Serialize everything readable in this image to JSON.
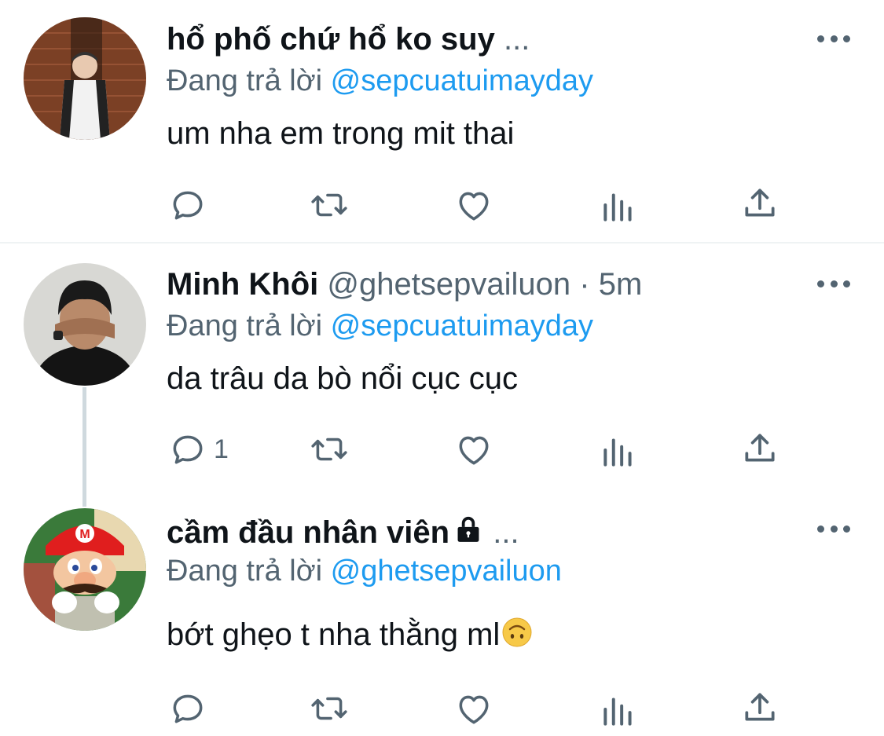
{
  "tweets": [
    {
      "name": "hổ phố chứ hổ ko suy",
      "ellipsis": "...",
      "reply_prefix": "Đang trả lời",
      "reply_to": "@sepcuatuimayday",
      "text": "um nha em trong mit thai",
      "reply_count": ""
    },
    {
      "name": "Minh Khôi",
      "handle": "@ghetsepvailuon",
      "dot": "·",
      "time": "5m",
      "reply_prefix": "Đang trả lời",
      "reply_to": "@sepcuatuimayday",
      "text": "da trâu da bò nổi cục cục",
      "reply_count": "1"
    },
    {
      "name": "cầm đầu nhân viên",
      "locked": true,
      "ellipsis": "...",
      "reply_prefix": "Đang trả lời",
      "reply_to": "@ghetsepvailuon",
      "text": "bớt ghẹo t nha thằng ml",
      "emoji": "upside-down-face-emoji",
      "reply_count": ""
    }
  ],
  "icons": [
    "reply-icon",
    "retweet-icon",
    "like-icon",
    "analytics-icon",
    "share-icon",
    "more-icon",
    "lock-icon"
  ],
  "colors": {
    "text": "#0f1419",
    "secondary": "#536471",
    "accent": "#1d9bf0",
    "divider": "#eff3f4",
    "thread": "#cfd9de"
  }
}
